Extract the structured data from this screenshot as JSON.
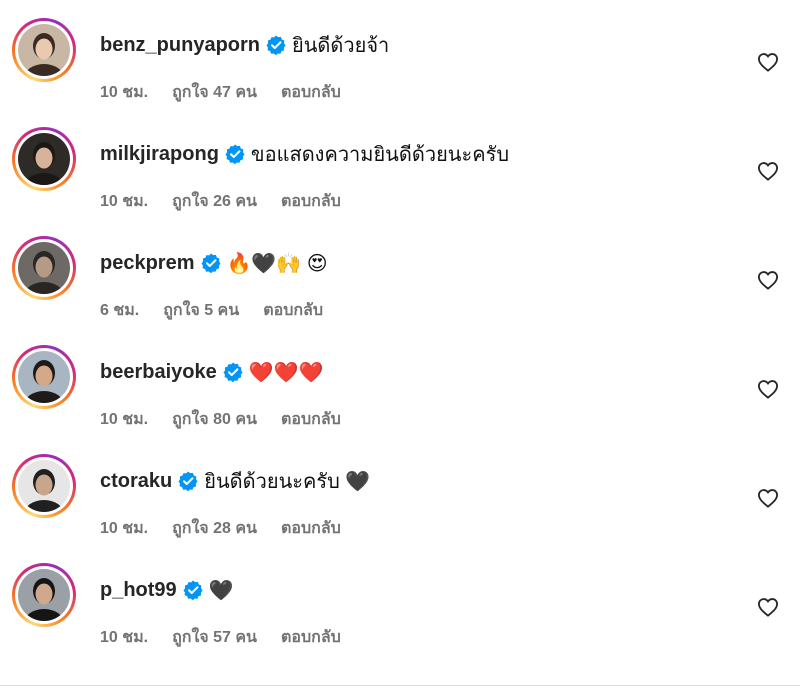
{
  "comments": [
    {
      "username": "benz_punyaporn",
      "text": "ยินดีด้วยจ้า",
      "time": "10 ชม.",
      "likes": "ถูกใจ 47 คน",
      "reply": "ตอบกลับ",
      "avatar": {
        "bg": "#c9b7a6",
        "skin": "#e9c9b0",
        "hair": "#3a2a22"
      }
    },
    {
      "username": "milkjirapong",
      "text": "ขอแสดงความยินดีด้วยนะครับ",
      "time": "10 ชม.",
      "likes": "ถูกใจ 26 คน",
      "reply": "ตอบกลับ",
      "avatar": {
        "bg": "#2e2a28",
        "skin": "#d8b399",
        "hair": "#1c1816"
      }
    },
    {
      "username": "peckprem",
      "text": "🔥🖤🙌 😍",
      "time": "6 ชม.",
      "likes": "ถูกใจ 5 คน",
      "reply": "ตอบกลับ",
      "avatar": {
        "bg": "#6d6a66",
        "skin": "#b59a86",
        "hair": "#2a2623"
      }
    },
    {
      "username": "beerbaiyoke",
      "text": "❤️❤️❤️",
      "time": "10 ชม.",
      "likes": "ถูกใจ 80 คน",
      "reply": "ตอบกลับ",
      "avatar": {
        "bg": "#a8b6c4",
        "skin": "#d4a98a",
        "hair": "#1f1a17"
      }
    },
    {
      "username": "ctoraku",
      "text": "ยินดีด้วยนะครับ 🖤",
      "time": "10 ชม.",
      "likes": "ถูกใจ 28 คน",
      "reply": "ตอบกลับ",
      "avatar": {
        "bg": "#e6e6e6",
        "skin": "#c9a58c",
        "hair": "#202020"
      }
    },
    {
      "username": "p_hot99",
      "text": "🖤",
      "time": "10 ชม.",
      "likes": "ถูกใจ 57 คน",
      "reply": "ตอบกลับ",
      "avatar": {
        "bg": "#9aa0a6",
        "skin": "#cfa88d",
        "hair": "#151515"
      }
    }
  ],
  "colors": {
    "verified": "#0095f6",
    "meta": "#737373",
    "text": "#262626"
  }
}
